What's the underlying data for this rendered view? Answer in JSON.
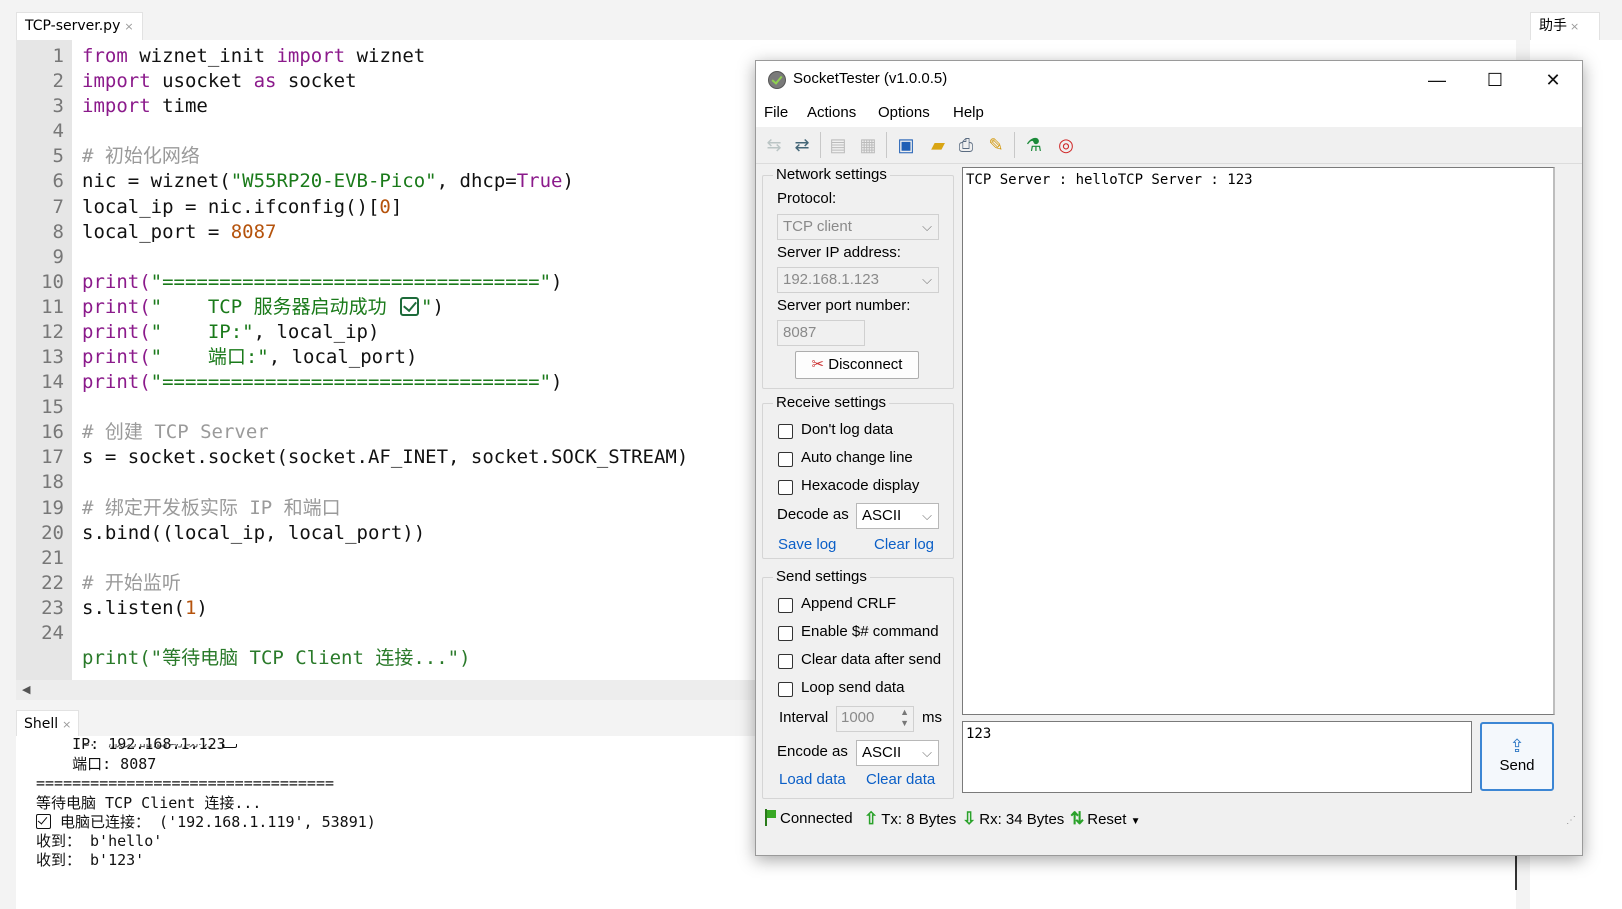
{
  "editor": {
    "tab_label": "TCP-server.py",
    "tab_close": "×",
    "line_numbers": [
      "1",
      "2",
      "3",
      "4",
      "5",
      "6",
      "7",
      "8",
      "9",
      "10",
      "11",
      "12",
      "13",
      "14",
      "15",
      "16",
      "17",
      "18",
      "19",
      "20",
      "21",
      "22",
      "23",
      "24"
    ],
    "code": {
      "l1": {
        "a": "from",
        "b": " wiznet_init ",
        "c": "import",
        "d": " wiznet"
      },
      "l2": {
        "a": "import",
        "b": " usocket ",
        "c": "as",
        "d": " socket"
      },
      "l3": {
        "a": "import",
        "b": " time"
      },
      "l5": "# 初始化网络",
      "l6": {
        "a": "nic = wiznet(",
        "b": "\"W55RP20-EVB-Pico\"",
        "c": ", dhcp=",
        "d": "True",
        "e": ")"
      },
      "l7": {
        "a": "local_ip = nic.ifconfig()[",
        "b": "0",
        "c": "]"
      },
      "l8": {
        "a": "local_port = ",
        "b": "8087"
      },
      "l10": {
        "a": "print(",
        "b": "\"=================================\"",
        "c": ")"
      },
      "l11": {
        "a": "print(",
        "b": "\"    TCP 服务器启动成功 ",
        "c": "\"",
        "d": ")"
      },
      "l12": {
        "a": "print(",
        "b": "\"    IP:\"",
        "c": ", local_ip)"
      },
      "l13": {
        "a": "print(",
        "b": "\"    端口:\"",
        "c": ", local_port)"
      },
      "l14": {
        "a": "print(",
        "b": "\"=================================\"",
        "c": ")"
      },
      "l16": "# 创建 TCP Server",
      "l17": "s = socket.socket(socket.AF_INET, socket.SOCK_STREAM)",
      "l19": "# 绑定开发板实际 IP 和端口",
      "l20": "s.bind((local_ip, local_port))",
      "l22": "# 开始监听",
      "l23": {
        "a": "s.listen(",
        "b": "1",
        "c": ")"
      },
      "l25": "print(\"等待电脑 TCP Client 连接...\")"
    }
  },
  "shell": {
    "tab_label": "Shell",
    "tab_close": "×",
    "lines": {
      "ip": "    IP: 192.168.1.123",
      "port": "    端口: 8087",
      "sep": "=================================",
      "wait": "等待电脑 TCP Client 连接...",
      "connected": " 电脑已连接： ('192.168.1.119', 53891)",
      "recv1": "收到： b'hello'",
      "recv2": "收到： b'123'"
    }
  },
  "assistant": {
    "tab_label": "助手",
    "tab_close": "×"
  },
  "socket_tester": {
    "title": "SocketTester (v1.0.0.5)",
    "window_buttons": {
      "minimize": "—",
      "maximize": "☐",
      "close": "✕"
    },
    "menu": [
      "File",
      "Actions",
      "Options",
      "Help"
    ],
    "network": {
      "title": "Network settings",
      "protocol_label": "Protocol:",
      "protocol_value": "TCP client",
      "server_ip_label": "Server IP address:",
      "server_ip_value": "192.168.1.123",
      "port_label": "Server port number:",
      "port_value": "8087",
      "disconnect_label": "Disconnect"
    },
    "receive": {
      "title": "Receive settings",
      "dont_log": "Don't log data",
      "auto_change_line": "Auto change line",
      "hexacode": "Hexacode display",
      "decode_label": "Decode as",
      "decode_value": "ASCII",
      "save_log": "Save log",
      "clear_log": "Clear log"
    },
    "send": {
      "title": "Send settings",
      "append_crlf": "Append CRLF",
      "enable_cmd": "Enable $# command",
      "clear_after": "Clear data after send",
      "loop_send": "Loop send data",
      "interval_label": "Interval",
      "interval_value": "1000",
      "interval_unit": "ms",
      "encode_label": "Encode as",
      "encode_value": "ASCII",
      "load_data": "Load data",
      "clear_data": "Clear data"
    },
    "log_text": "TCP Server : helloTCP Server : 123",
    "send_text": "123",
    "send_button": "Send",
    "status": {
      "connected": "Connected",
      "tx": "Tx: 8 Bytes",
      "rx": "Rx: 34 Bytes",
      "reset": "Reset"
    }
  }
}
